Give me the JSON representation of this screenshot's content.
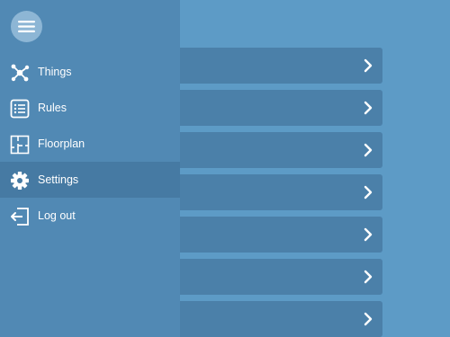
{
  "drawer": {
    "menu_icon": "hamburger-icon",
    "items": [
      {
        "label": "Things",
        "icon": "things-network-icon",
        "active": false
      },
      {
        "label": "Rules",
        "icon": "rules-list-icon",
        "active": false
      },
      {
        "label": "Floorplan",
        "icon": "floorplan-icon",
        "active": false
      },
      {
        "label": "Settings",
        "icon": "gear-icon",
        "active": true
      },
      {
        "label": "Log out",
        "icon": "logout-icon",
        "active": false
      }
    ]
  },
  "background_list": {
    "row_count": 7,
    "row_icon": "chevron-right-icon"
  },
  "colors": {
    "page_background": "#5d9bc6",
    "drawer_background": "#5189b4",
    "active_item_background": "#467aa3",
    "row_background": "#4b80a9",
    "menu_button_background": "#8db6d5"
  }
}
